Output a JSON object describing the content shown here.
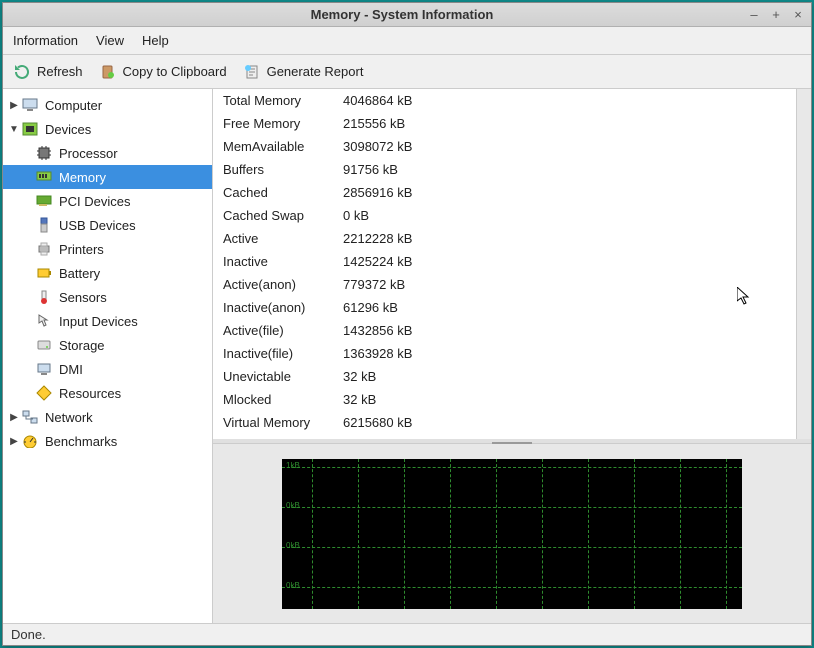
{
  "window": {
    "title": "Memory - System Information"
  },
  "menu": {
    "information": "Information",
    "view": "View",
    "help": "Help"
  },
  "toolbar": {
    "refresh": "Refresh",
    "copy": "Copy to Clipboard",
    "report": "Generate Report"
  },
  "sidebar": {
    "computer": "Computer",
    "devices": "Devices",
    "network": "Network",
    "benchmarks": "Benchmarks",
    "devitems": [
      {
        "label": "Processor",
        "icon": "cpu",
        "selected": false
      },
      {
        "label": "Memory",
        "icon": "memory",
        "selected": true
      },
      {
        "label": "PCI Devices",
        "icon": "pci",
        "selected": false
      },
      {
        "label": "USB Devices",
        "icon": "usb",
        "selected": false
      },
      {
        "label": "Printers",
        "icon": "printer",
        "selected": false
      },
      {
        "label": "Battery",
        "icon": "battery",
        "selected": false
      },
      {
        "label": "Sensors",
        "icon": "sensor",
        "selected": false
      },
      {
        "label": "Input Devices",
        "icon": "input",
        "selected": false
      },
      {
        "label": "Storage",
        "icon": "storage",
        "selected": false
      },
      {
        "label": "DMI",
        "icon": "dmi",
        "selected": false
      },
      {
        "label": "Resources",
        "icon": "resource",
        "selected": false
      }
    ]
  },
  "memrows": [
    {
      "k": "Total Memory",
      "v": "4046864 kB"
    },
    {
      "k": "Free Memory",
      "v": "215556 kB"
    },
    {
      "k": "MemAvailable",
      "v": "3098072 kB"
    },
    {
      "k": "Buffers",
      "v": "91756 kB"
    },
    {
      "k": "Cached",
      "v": "2856916 kB"
    },
    {
      "k": "Cached Swap",
      "v": "0 kB"
    },
    {
      "k": "Active",
      "v": "2212228 kB"
    },
    {
      "k": "Inactive",
      "v": "1425224 kB"
    },
    {
      "k": "Active(anon)",
      "v": "779372 kB"
    },
    {
      "k": "Inactive(anon)",
      "v": "61296 kB"
    },
    {
      "k": "Active(file)",
      "v": "1432856 kB"
    },
    {
      "k": "Inactive(file)",
      "v": "1363928 kB"
    },
    {
      "k": "Unevictable",
      "v": "32 kB"
    },
    {
      "k": "Mlocked",
      "v": "32 kB"
    },
    {
      "k": "Virtual Memory",
      "v": "6215680 kB"
    }
  ],
  "graph": {
    "ylabels": [
      "1kB",
      "0kB",
      "0kB",
      "0kB"
    ]
  },
  "status": {
    "text": "Done."
  },
  "chart_data": {
    "type": "line",
    "title": "",
    "xlabel": "",
    "ylabel": "",
    "ylim": [
      0,
      1
    ],
    "y_tick_labels": [
      "1kB",
      "0kB",
      "0kB",
      "0kB"
    ],
    "x": [],
    "series": [],
    "grid": true,
    "note": "Empty history graph; no data series plotted yet in the screenshot."
  }
}
